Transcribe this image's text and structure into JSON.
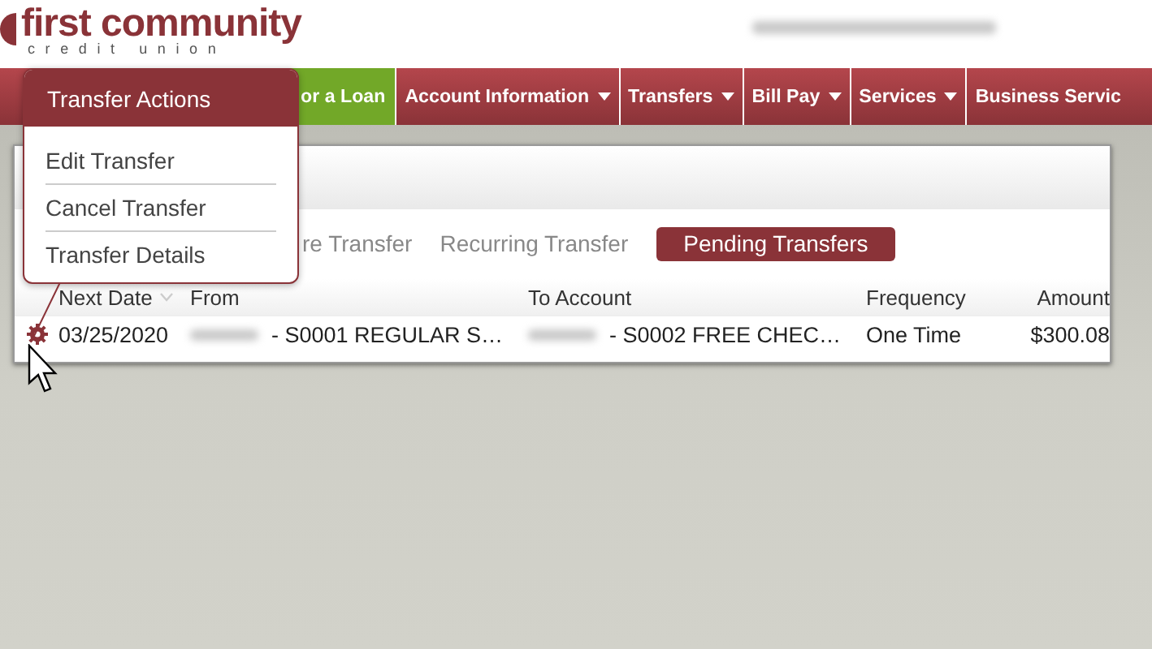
{
  "header": {
    "logo_name": "first community",
    "logo_sub": "credit union"
  },
  "nav": [
    {
      "label": "or a Loan",
      "highlight": true,
      "dropdown": false
    },
    {
      "label": "Account Information",
      "highlight": false,
      "dropdown": true
    },
    {
      "label": "Transfers",
      "highlight": false,
      "dropdown": true
    },
    {
      "label": "Bill Pay",
      "highlight": false,
      "dropdown": true
    },
    {
      "label": "Services",
      "highlight": false,
      "dropdown": true
    },
    {
      "label": "Business Servic",
      "highlight": false,
      "dropdown": false
    }
  ],
  "popup": {
    "title": "Transfer Actions",
    "items": [
      "Edit Transfer",
      "Cancel Transfer",
      "Transfer Details"
    ]
  },
  "tabs": [
    {
      "label": "re Transfer",
      "selected": false
    },
    {
      "label": "Recurring Transfer",
      "selected": false
    },
    {
      "label": "Pending Transfers",
      "selected": true
    }
  ],
  "table": {
    "columns": [
      {
        "label": "Next Date",
        "sorted": true
      },
      {
        "label": "From"
      },
      {
        "label": "To Account"
      },
      {
        "label": "Frequency"
      },
      {
        "label": "Amount"
      }
    ],
    "rows": [
      {
        "next_date": "03/25/2020",
        "from": "- S0001 REGULAR S…",
        "to": "- S0002 FREE CHEC…",
        "frequency": "One Time",
        "amount": "$300.08"
      }
    ]
  }
}
